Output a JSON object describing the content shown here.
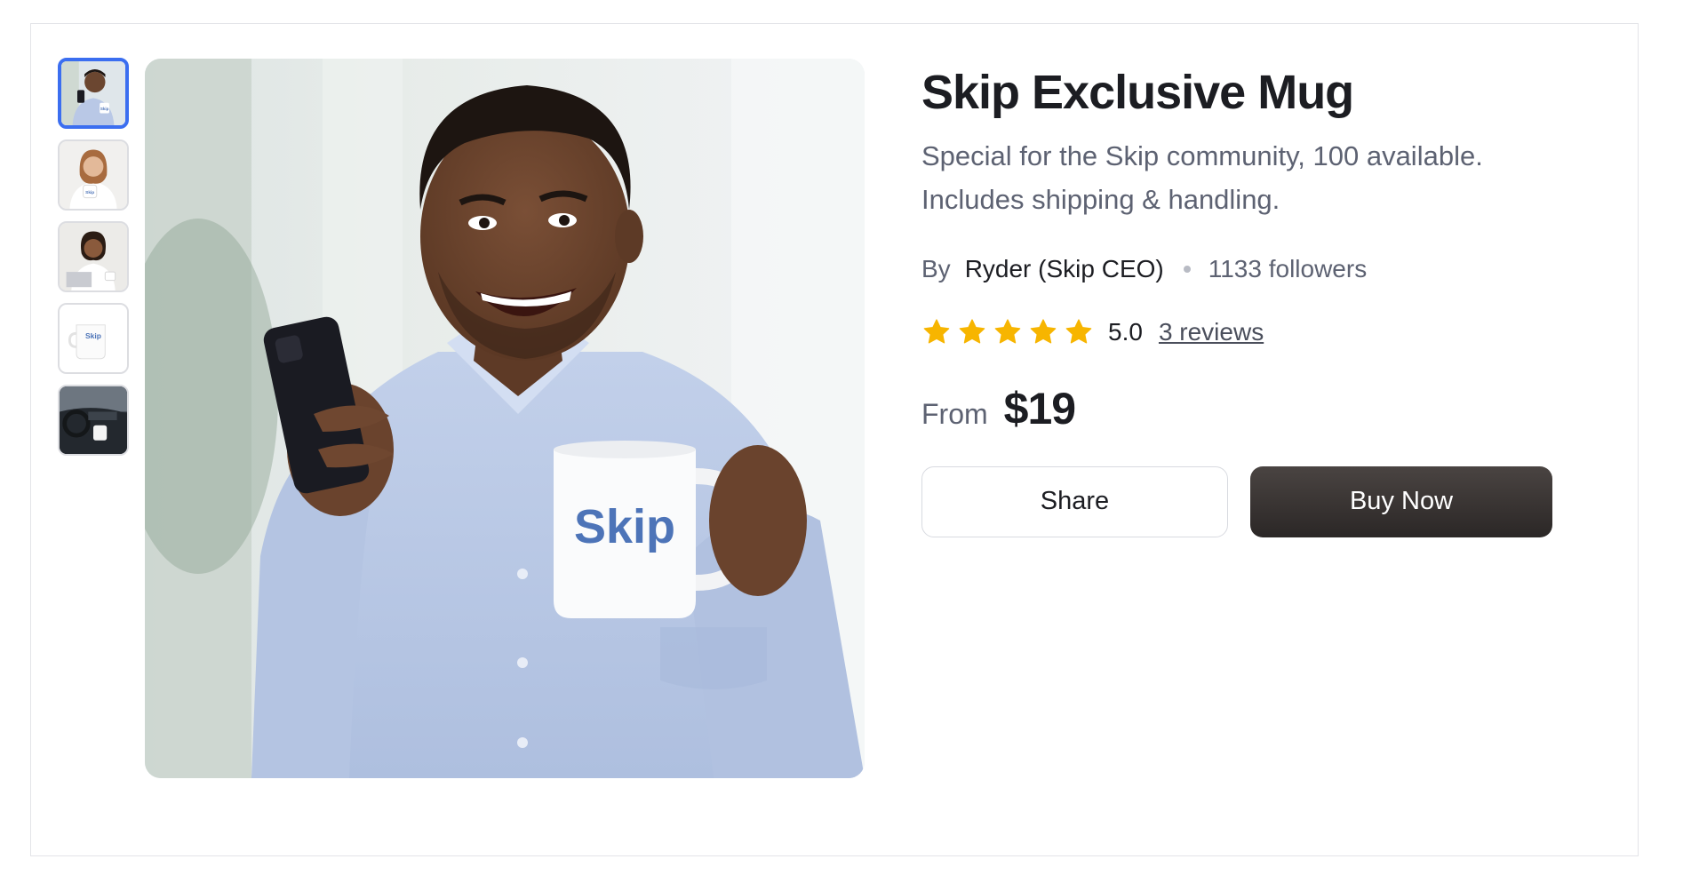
{
  "product": {
    "title": "Skip Exclusive Mug",
    "description": "Special for the Skip community, 100 available. Includes shipping & handling.",
    "byline": {
      "prefix": "By",
      "author": "Ryder (Skip CEO)",
      "followers": "1133 followers"
    },
    "rating": {
      "stars": 5,
      "value": "5.0",
      "reviews_label": "3 reviews",
      "star_color": "#f7b500"
    },
    "price": {
      "prefix": "From",
      "amount": "$19"
    },
    "mug_logo_text": "Skip"
  },
  "gallery": {
    "thumbnails": [
      {
        "name": "thumb-man-phone-mug",
        "active": true
      },
      {
        "name": "thumb-woman-mug",
        "active": false
      },
      {
        "name": "thumb-woman-laptop",
        "active": false
      },
      {
        "name": "thumb-mug-only",
        "active": false
      },
      {
        "name": "thumb-car-mug",
        "active": false
      }
    ],
    "selected_index": 0
  },
  "actions": {
    "share_label": "Share",
    "buy_label": "Buy Now"
  },
  "colors": {
    "active_thumb_border": "#3b6ef0",
    "buy_button_bg": "#2f2b2a",
    "mug_logo": "#4d74b8"
  }
}
